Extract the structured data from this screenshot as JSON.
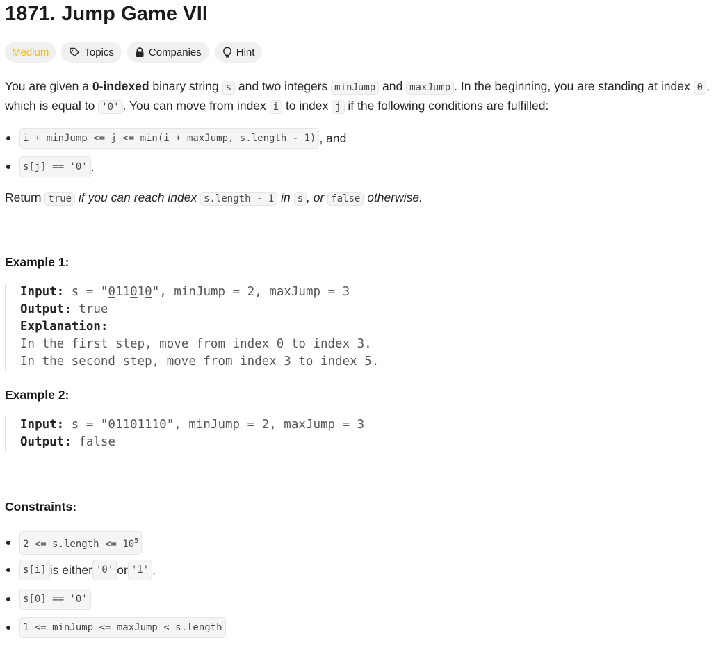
{
  "problem": {
    "title": "1871. Jump Game VII"
  },
  "badges": {
    "difficulty": "Medium",
    "topics": "Topics",
    "companies": "Companies",
    "hint": "Hint"
  },
  "icons": {
    "topics": "tag-icon",
    "companies": "lock-icon",
    "hint": "lightbulb-icon"
  },
  "colors": {
    "difficulty_medium": "#ffb800"
  },
  "description": {
    "p1": {
      "t1": "You are given a ",
      "bold": "0-indexed",
      "t2": " binary string ",
      "c1": "s",
      "t3": " and two integers ",
      "c2": "minJump",
      "t4": " and ",
      "c3": "maxJump",
      "t5": ". In the beginning, you are standing at index ",
      "c4": "0",
      "t6": ",",
      "t7": "which is equal to ",
      "c5": "'0'",
      "t8": ". You can move from index ",
      "c6": "i",
      "t9": " to index ",
      "c7": "j",
      "t10": " if the following conditions are fulfilled:"
    },
    "conditions": [
      {
        "code": "i + minJump <= j <= min(i + maxJump, s.length - 1)",
        "suffix": ", and"
      },
      {
        "code": "s[j] == '0'",
        "suffix": "."
      }
    ],
    "ret": {
      "t1": "Return ",
      "c1": "true",
      "t2": " if you can reach index ",
      "c2": "s.length - 1",
      "t3": " in ",
      "c3": "s",
      "t4": ", or ",
      "c4": "false",
      "t5": " otherwise."
    }
  },
  "examples": [
    {
      "heading": "Example 1:",
      "input_label": "Input:",
      "input_pre": " s = \"",
      "input_s": [
        "0",
        "1",
        "1",
        "0",
        "1",
        "0"
      ],
      "input_post": "\", minJump = 2, maxJump = 3",
      "output_label": "Output:",
      "output": " true",
      "explanation_label": "Explanation:",
      "explanation": [
        "In the first step, move from index 0 to index 3.",
        "In the second step, move from index 3 to index 5."
      ]
    },
    {
      "heading": "Example 2:",
      "input_label": "Input:",
      "input": " s = \"01101110\", minJump = 2, maxJump = 3",
      "output_label": "Output:",
      "output": " false"
    }
  ],
  "constraints": {
    "heading": "Constraints:",
    "c1": {
      "pre": "2 <= s.length <= 10",
      "sup": "5"
    },
    "c2": {
      "code1": "s[i]",
      "t1": " is either ",
      "code2": "'0'",
      "t2": " or ",
      "code3": "'1'",
      "t3": "."
    },
    "c3": {
      "code": "s[0] == '0'"
    },
    "c4": {
      "code": "1 <= minJump <= maxJump < s.length"
    }
  }
}
